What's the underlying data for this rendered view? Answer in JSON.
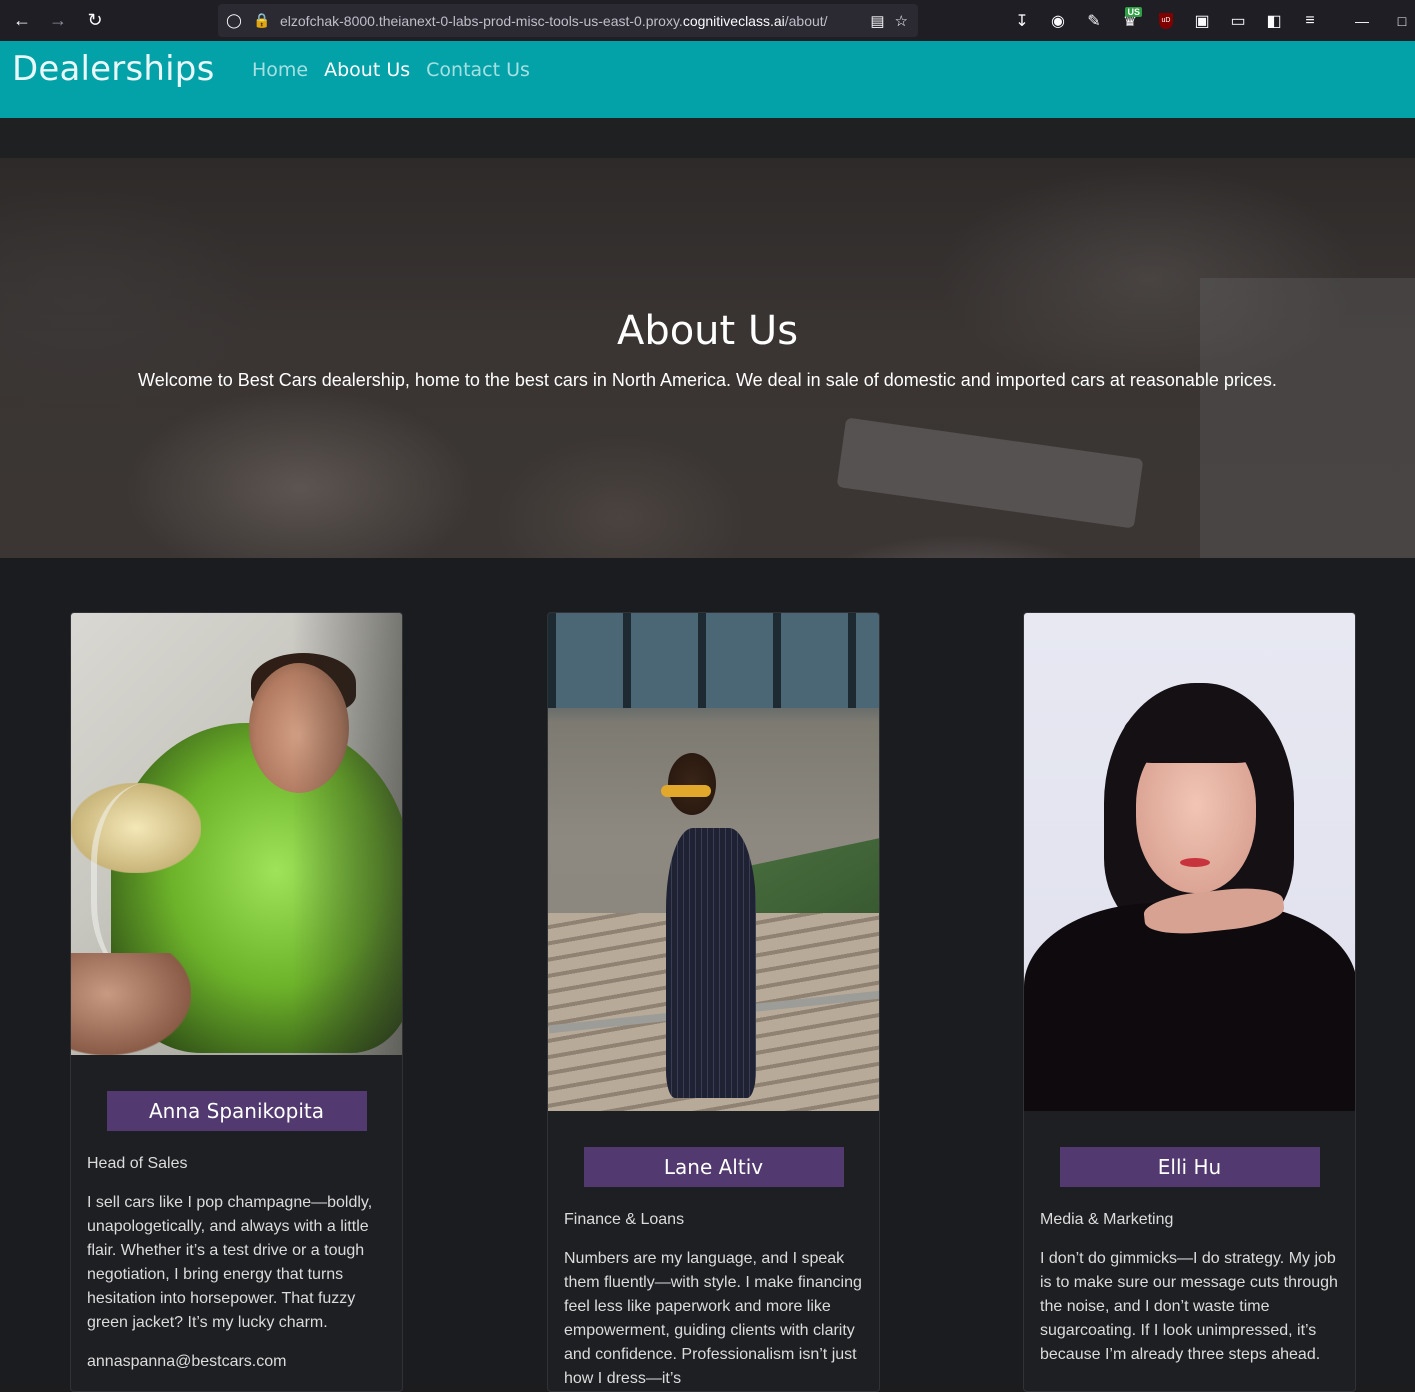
{
  "browser": {
    "url_prefix": "elzofchak-8000.theianext-0-labs-prod-misc-tools-us-east-0.proxy.",
    "url_domain": "cognitiveclass.ai",
    "url_suffix": "/about/",
    "extension_badge": "US",
    "ublock_label": "uD"
  },
  "navbar": {
    "brand": "Dealerships",
    "links": [
      {
        "label": "Home",
        "active": false
      },
      {
        "label": "About Us",
        "active": true
      },
      {
        "label": "Contact Us",
        "active": false
      }
    ]
  },
  "hero": {
    "title": "About Us",
    "text": "Welcome to Best Cars dealership, home to the best cars in North America. We deal in sale of domestic and imported cars at reasonable prices."
  },
  "team": [
    {
      "name": "Anna Spanikopita",
      "role": "Head of Sales",
      "bio": "I sell cars like I pop champagne—boldly, unapologetically, and always with a little flair. Whether it’s a test drive or a tough negotiation, I bring energy that turns hesitation into horsepower. That fuzzy green jacket? It’s my lucky charm.",
      "email": "annaspanna@bestcars.com"
    },
    {
      "name": "Lane Altiv",
      "role": "Finance & Loans",
      "bio": "Numbers are my language, and I speak them fluently—with style. I make financing feel less like paperwork and more like empowerment, guiding clients with clarity and confidence. Professionalism isn’t just how I dress—it’s",
      "email": ""
    },
    {
      "name": "Elli Hu",
      "role": "Media & Marketing",
      "bio": "I don’t do gimmicks—I do strategy. My job is to make sure our message cuts through the noise, and I don’t waste time sugarcoating. If I look unimpressed, it’s because I’m already three steps ahead.",
      "email": ""
    }
  ]
}
